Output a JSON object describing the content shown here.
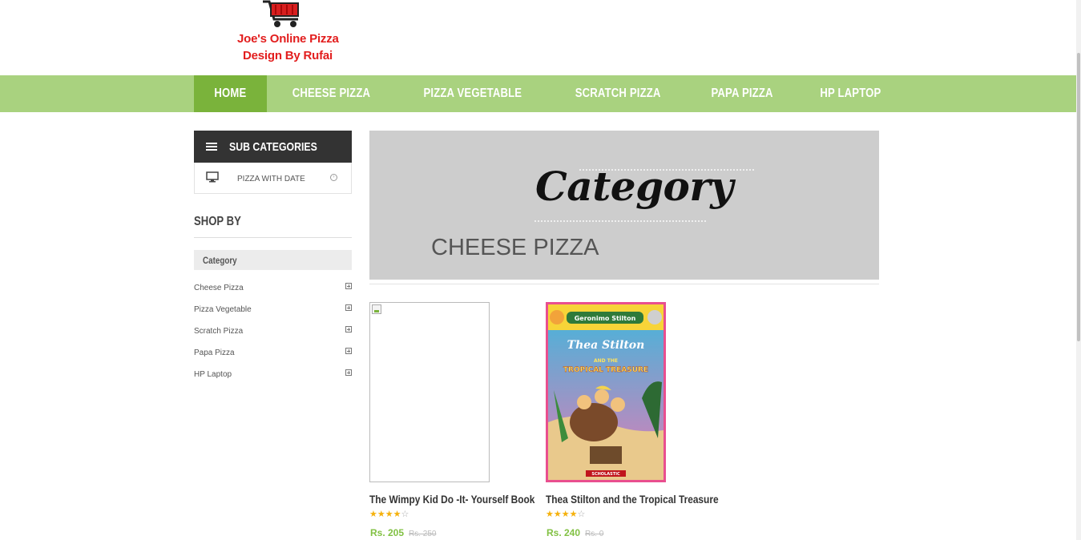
{
  "logo": {
    "line1": "Joe's Online Pizza",
    "line2": "Design By Rufai",
    "icon": "shopping-cart-icon",
    "color": "#e21d1d"
  },
  "nav": {
    "items": [
      {
        "label": "HOME",
        "active": true
      },
      {
        "label": "CHEESE PIZZA",
        "active": false
      },
      {
        "label": "PIZZA VEGETABLE",
        "active": false
      },
      {
        "label": "SCRATCH PIZZA",
        "active": false
      },
      {
        "label": "PAPA PIZZA",
        "active": false
      },
      {
        "label": "HP LAPTOP",
        "active": false
      }
    ],
    "bar_color": "#a9d27f",
    "active_color": "#7ab33b"
  },
  "sidebar": {
    "subcategories_title": "SUB CATEGORIES",
    "subcategories": [
      {
        "label": "PIZZA WITH DATE",
        "icon": "monitor-icon"
      }
    ],
    "shop_by_title": "SHOP BY",
    "category_heading": "Category",
    "filters": [
      {
        "label": "Cheese Pizza"
      },
      {
        "label": "Pizza Vegetable"
      },
      {
        "label": "Scratch Pizza"
      },
      {
        "label": "Papa Pizza"
      },
      {
        "label": "HP Laptop"
      }
    ]
  },
  "banner": {
    "script_title": "Category",
    "category_name": "CHEESE PIZZA"
  },
  "products": [
    {
      "name": "The Wimpy Kid Do -It- Yourself Book",
      "rating": 4,
      "rating_max": 5,
      "price": "Rs. 205",
      "old_price": "Rs. 250",
      "image": "broken-image"
    },
    {
      "name": "Thea Stilton and the Tropical Treasure",
      "rating": 4,
      "rating_max": 5,
      "price": "Rs. 240",
      "old_price": "Rs. 0",
      "image": "book-cover",
      "cover_text": {
        "series": "Geronimo Stilton",
        "title": "Thea Stilton",
        "subtitle1": "AND THE",
        "subtitle2": "TROPICAL TREASURE",
        "publisher": "SCHOLASTIC"
      }
    }
  ]
}
